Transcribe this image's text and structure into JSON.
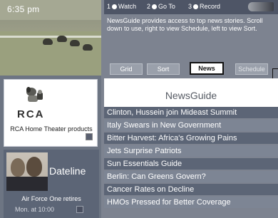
{
  "status": {
    "clock": "6:35 pm"
  },
  "top_nav": {
    "items": [
      {
        "number": "1",
        "label": "Watch"
      },
      {
        "number": "2",
        "label": "Go To"
      },
      {
        "number": "3",
        "label": "Record"
      }
    ],
    "remote_icon": "remote-control-icon"
  },
  "info": {
    "text": "NewsGuide provides access to top news stories. Scroll down to use, right to view Schedule, left to view Sort."
  },
  "tabs": [
    {
      "label": "Grid",
      "active": false
    },
    {
      "label": "Sort",
      "active": false
    },
    {
      "label": "News",
      "active": true
    },
    {
      "label": "Schedule",
      "active": false
    }
  ],
  "guide": {
    "title": "NewsGuide"
  },
  "stories": [
    "Clinton, Hussein join Mideast Summit",
    "Italy Swears in New Government",
    "Bitter Harvest: Africa's Growing Pains",
    "Jets Surprise Patriots",
    "Sun Essentials Guide",
    "Berlin: Can Greens Govern?",
    "Cancer Rates on Decline",
    "HMOs Pressed for Better Coverage"
  ],
  "ads": {
    "rca": {
      "logo": "RCA",
      "product": "RCA Home Theater products",
      "icon": "rca-dog-icon"
    },
    "dateline": {
      "title": "Dateline",
      "subtitle": "Air Force One retires",
      "time": "Mon. at 10:00"
    }
  }
}
